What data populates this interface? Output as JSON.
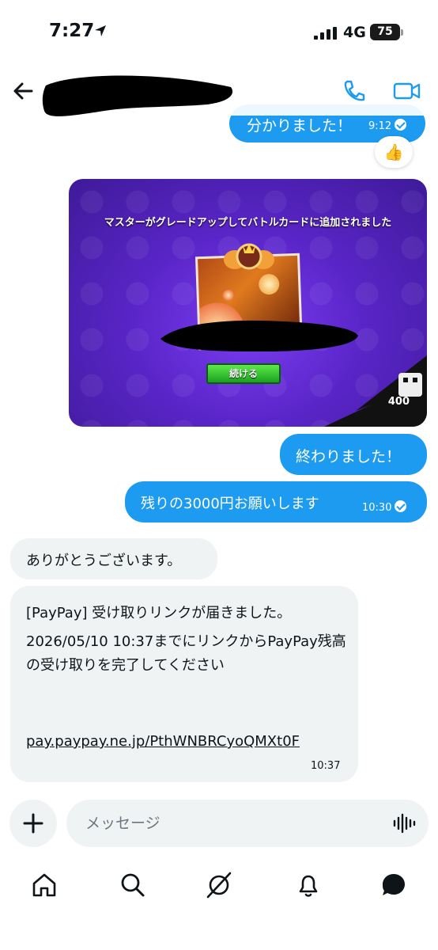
{
  "status_bar": {
    "time": "7:27",
    "network": "4G",
    "battery": "75"
  },
  "header": {
    "back_icon": "arrow-left-icon",
    "call_icon": "phone-icon",
    "video_icon": "video-camera-icon"
  },
  "messages": [
    {
      "direction": "outgoing",
      "text": "分かりました！",
      "time": "9:12",
      "read": true,
      "reaction": "👍"
    },
    {
      "direction": "outgoing",
      "type": "image",
      "image": {
        "caption": "マスターがグレードアップしてバトルカードに追加されました",
        "button": "続ける",
        "trophy_count": "400"
      }
    },
    {
      "direction": "outgoing",
      "text": "終わりました！"
    },
    {
      "direction": "outgoing",
      "text": "残りの3000円お願いします",
      "time": "10:30",
      "read": true
    },
    {
      "direction": "incoming",
      "text": "ありがとうございます。"
    },
    {
      "direction": "incoming",
      "text_line1": "[PayPay] 受け取りリンクが届きました。",
      "text_line2": "2026/05/10 10:37までにリンクからPayPay残高の受け取りを完了してください",
      "link": "pay.paypay.ne.jp/PthWNBRCyoQMXt0F",
      "time": "10:37"
    }
  ],
  "composer": {
    "placeholder": "メッセージ",
    "add_icon": "plus-icon",
    "voice_icon": "voice-waveform-icon"
  },
  "tab_bar": {
    "items": [
      "home-icon",
      "search-icon",
      "grok-icon",
      "notifications-bell-icon",
      "messages-icon"
    ]
  },
  "colors": {
    "accent": "#1d9bf0",
    "incoming_bubble": "#eff3f4",
    "text": "#0f1419",
    "muted": "#6e767d"
  }
}
